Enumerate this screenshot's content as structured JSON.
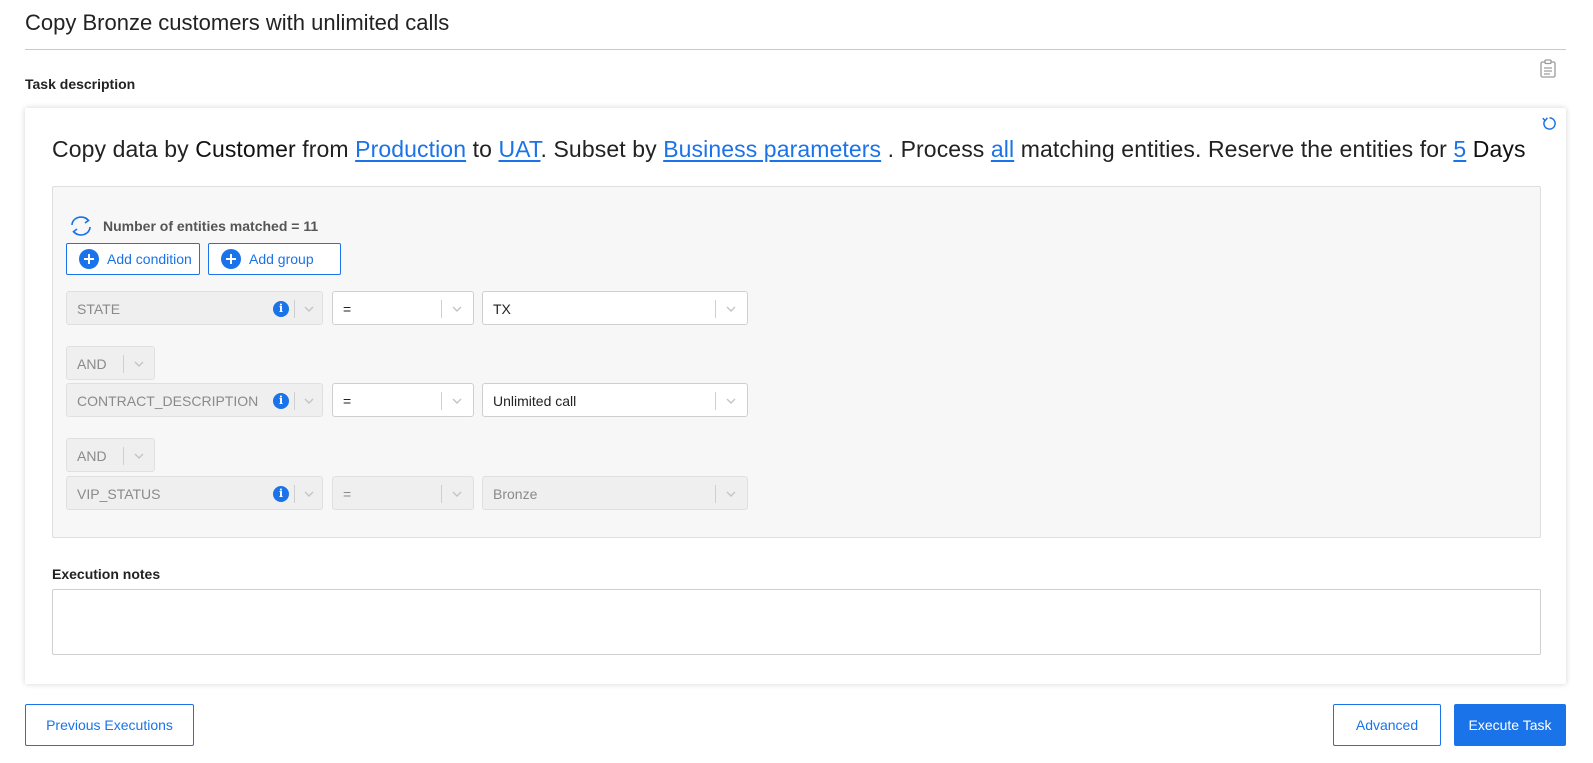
{
  "page": {
    "title": "Copy Bronze customers with unlimited calls",
    "section_label": "Task description"
  },
  "sentence": {
    "p1": "Copy data by ",
    "entity": "Customer",
    "p2": " from ",
    "source": "Production",
    "p3": " to ",
    "target": "UAT",
    "p4": ". Subset by ",
    "subset": "Business parameters",
    "p5": " . Process ",
    "process": "all",
    "p6": " matching entities. Reserve the entities for ",
    "reserve_num": "5",
    "p7": " ",
    "reserve_unit": "Days"
  },
  "filter": {
    "match_text": "Number of entities matched = 11",
    "add_condition": "Add condition",
    "add_group": "Add group",
    "conditions": [
      {
        "field": "STATE",
        "operator": "=",
        "value": "TX"
      },
      {
        "field": "CONTRACT_DESCRIPTION",
        "operator": "=",
        "value": "Unlimited call"
      },
      {
        "field": "VIP_STATUS",
        "operator": "=",
        "value": "Bronze"
      }
    ],
    "connectors": [
      "AND",
      "AND"
    ],
    "info_glyph": "i"
  },
  "notes": {
    "label": "Execution notes",
    "value": ""
  },
  "footer": {
    "previous": "Previous Executions",
    "advanced": "Advanced",
    "execute": "Execute Task"
  },
  "colors": {
    "accent": "#1a73e8",
    "disabled_bg": "#efefef",
    "panel_bg": "#f7f7f7"
  },
  "icons": {
    "clipboard": "clipboard-icon",
    "reset": "reset-icon",
    "sync": "sync-icon",
    "info": "info-icon",
    "chevron": "chevron-down-icon",
    "plus": "plus-circle-icon"
  }
}
